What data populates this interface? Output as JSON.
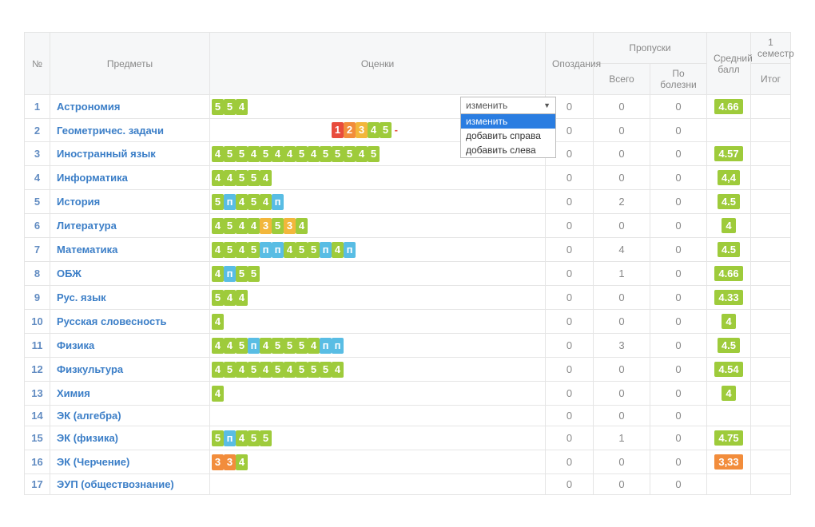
{
  "headers": {
    "num": "№",
    "subject": "Предметы",
    "grades": "Оценки",
    "late": "Опоздания",
    "absences": "Пропуски",
    "abs_total": "Всего",
    "abs_sick": "По болезни",
    "avg": "Средний балл",
    "sem_top": "1 семестр",
    "sem_bottom": "Итог"
  },
  "ruler": [
    "1",
    "2",
    "3",
    "4",
    "5",
    "-"
  ],
  "dropdown": {
    "selected": "изменить",
    "options": [
      "изменить",
      "добавить справа",
      "добавить слева"
    ]
  },
  "rows": [
    {
      "n": "1",
      "subj": "Астрономия",
      "grades": [
        {
          "t": "g",
          "v": "5"
        },
        {
          "t": "g",
          "v": "5"
        },
        {
          "t": "g",
          "v": "4"
        }
      ],
      "late": "0",
      "abs": "0",
      "sick": "0",
      "avg": "4.66",
      "avgc": "g"
    },
    {
      "n": "2",
      "subj": "Геометричес. задачи",
      "grades": [],
      "late": "0",
      "abs": "0",
      "sick": "0",
      "avg": "",
      "avgc": ""
    },
    {
      "n": "3",
      "subj": "Иностранный язык",
      "grades": [
        {
          "t": "g",
          "v": "4"
        },
        {
          "t": "g",
          "v": "5"
        },
        {
          "t": "g",
          "v": "5"
        },
        {
          "t": "g",
          "v": "4"
        },
        {
          "t": "g",
          "v": "5"
        },
        {
          "t": "g",
          "v": "4"
        },
        {
          "t": "g",
          "v": "4"
        },
        {
          "t": "g",
          "v": "5"
        },
        {
          "t": "g",
          "v": "4"
        },
        {
          "t": "g",
          "v": "5"
        },
        {
          "t": "g",
          "v": "5"
        },
        {
          "t": "g",
          "v": "5"
        },
        {
          "t": "g",
          "v": "4"
        },
        {
          "t": "g",
          "v": "5"
        }
      ],
      "late": "0",
      "abs": "0",
      "sick": "0",
      "avg": "4.57",
      "avgc": "g"
    },
    {
      "n": "4",
      "subj": "Информатика",
      "grades": [
        {
          "t": "g",
          "v": "4"
        },
        {
          "t": "g",
          "v": "4"
        },
        {
          "t": "g",
          "v": "5"
        },
        {
          "t": "g",
          "v": "5"
        },
        {
          "t": "g",
          "v": "4"
        }
      ],
      "late": "0",
      "abs": "0",
      "sick": "0",
      "avg": "4,4",
      "avgc": "g"
    },
    {
      "n": "5",
      "subj": "История",
      "grades": [
        {
          "t": "g",
          "v": "5"
        },
        {
          "t": "p",
          "v": "п"
        },
        {
          "t": "g",
          "v": "4"
        },
        {
          "t": "g",
          "v": "5"
        },
        {
          "t": "g",
          "v": "4"
        },
        {
          "t": "p",
          "v": "п"
        }
      ],
      "late": "0",
      "abs": "2",
      "sick": "0",
      "avg": "4.5",
      "avgc": "g"
    },
    {
      "n": "6",
      "subj": "Литература",
      "grades": [
        {
          "t": "g",
          "v": "4"
        },
        {
          "t": "g",
          "v": "5"
        },
        {
          "t": "g",
          "v": "4"
        },
        {
          "t": "g",
          "v": "4"
        },
        {
          "t": "r3",
          "v": "3"
        },
        {
          "t": "g",
          "v": "5"
        },
        {
          "t": "r3",
          "v": "3"
        },
        {
          "t": "g",
          "v": "4"
        }
      ],
      "late": "0",
      "abs": "0",
      "sick": "0",
      "avg": "4",
      "avgc": "g"
    },
    {
      "n": "7",
      "subj": "Математика",
      "grades": [
        {
          "t": "g",
          "v": "4"
        },
        {
          "t": "g",
          "v": "5"
        },
        {
          "t": "g",
          "v": "4"
        },
        {
          "t": "g",
          "v": "5"
        },
        {
          "t": "p",
          "v": "п"
        },
        {
          "t": "p",
          "v": "п"
        },
        {
          "t": "g",
          "v": "4"
        },
        {
          "t": "g",
          "v": "5"
        },
        {
          "t": "g",
          "v": "5"
        },
        {
          "t": "p",
          "v": "п"
        },
        {
          "t": "g",
          "v": "4"
        },
        {
          "t": "p",
          "v": "п"
        }
      ],
      "late": "0",
      "abs": "4",
      "sick": "0",
      "avg": "4.5",
      "avgc": "g"
    },
    {
      "n": "8",
      "subj": "ОБЖ",
      "grades": [
        {
          "t": "g",
          "v": "4"
        },
        {
          "t": "p",
          "v": "п"
        },
        {
          "t": "g",
          "v": "5"
        },
        {
          "t": "g",
          "v": "5"
        }
      ],
      "late": "0",
      "abs": "1",
      "sick": "0",
      "avg": "4.66",
      "avgc": "g"
    },
    {
      "n": "9",
      "subj": "Рус. язык",
      "grades": [
        {
          "t": "g",
          "v": "5"
        },
        {
          "t": "g",
          "v": "4"
        },
        {
          "t": "g",
          "v": "4"
        }
      ],
      "late": "0",
      "abs": "0",
      "sick": "0",
      "avg": "4.33",
      "avgc": "g"
    },
    {
      "n": "10",
      "subj": "Русская словесность",
      "grades": [
        {
          "t": "g",
          "v": "4"
        }
      ],
      "late": "0",
      "abs": "0",
      "sick": "0",
      "avg": "4",
      "avgc": "g"
    },
    {
      "n": "11",
      "subj": "Физика",
      "grades": [
        {
          "t": "g",
          "v": "4"
        },
        {
          "t": "g",
          "v": "4"
        },
        {
          "t": "g",
          "v": "5"
        },
        {
          "t": "p",
          "v": "п"
        },
        {
          "t": "g",
          "v": "4"
        },
        {
          "t": "g",
          "v": "5"
        },
        {
          "t": "g",
          "v": "5"
        },
        {
          "t": "g",
          "v": "5"
        },
        {
          "t": "g",
          "v": "4"
        },
        {
          "t": "p",
          "v": "п"
        },
        {
          "t": "p",
          "v": "п"
        }
      ],
      "late": "0",
      "abs": "3",
      "sick": "0",
      "avg": "4.5",
      "avgc": "g"
    },
    {
      "n": "12",
      "subj": "Физкультура",
      "grades": [
        {
          "t": "g",
          "v": "4"
        },
        {
          "t": "g",
          "v": "5"
        },
        {
          "t": "g",
          "v": "4"
        },
        {
          "t": "g",
          "v": "5"
        },
        {
          "t": "g",
          "v": "4"
        },
        {
          "t": "g",
          "v": "5"
        },
        {
          "t": "g",
          "v": "4"
        },
        {
          "t": "g",
          "v": "5"
        },
        {
          "t": "g",
          "v": "5"
        },
        {
          "t": "g",
          "v": "5"
        },
        {
          "t": "g",
          "v": "4"
        }
      ],
      "late": "0",
      "abs": "0",
      "sick": "0",
      "avg": "4.54",
      "avgc": "g"
    },
    {
      "n": "13",
      "subj": "Химия",
      "grades": [
        {
          "t": "g",
          "v": "4"
        }
      ],
      "late": "0",
      "abs": "0",
      "sick": "0",
      "avg": "4",
      "avgc": "g"
    },
    {
      "n": "14",
      "subj": "ЭК (алгебра)",
      "grades": [],
      "late": "0",
      "abs": "0",
      "sick": "0",
      "avg": "",
      "avgc": ""
    },
    {
      "n": "15",
      "subj": "ЭК (физика)",
      "grades": [
        {
          "t": "g",
          "v": "5"
        },
        {
          "t": "p",
          "v": "п"
        },
        {
          "t": "g",
          "v": "4"
        },
        {
          "t": "g",
          "v": "5"
        },
        {
          "t": "g",
          "v": "5"
        }
      ],
      "late": "0",
      "abs": "1",
      "sick": "0",
      "avg": "4.75",
      "avgc": "g"
    },
    {
      "n": "16",
      "subj": "ЭК (Черчение)",
      "grades": [
        {
          "t": "r2",
          "v": "3"
        },
        {
          "t": "r2",
          "v": "3"
        },
        {
          "t": "g",
          "v": "4"
        }
      ],
      "late": "0",
      "abs": "0",
      "sick": "0",
      "avg": "3,33",
      "avgc": "o"
    },
    {
      "n": "17",
      "subj": "ЭУП (обществознание)",
      "grades": [],
      "late": "0",
      "abs": "0",
      "sick": "0",
      "avg": "",
      "avgc": ""
    }
  ]
}
